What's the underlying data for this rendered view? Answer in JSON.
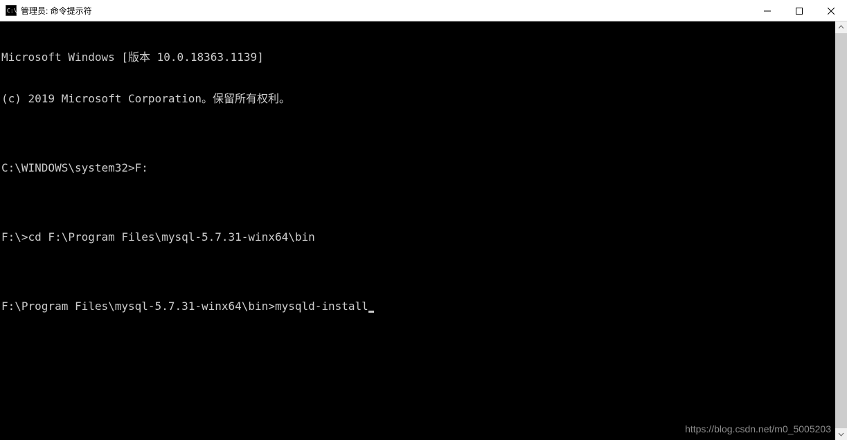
{
  "window": {
    "title": "管理员: 命令提示符"
  },
  "terminal": {
    "line1": "Microsoft Windows [版本 10.0.18363.1139]",
    "line2": "(c) 2019 Microsoft Corporation。保留所有权利。",
    "blank1": "",
    "prompt1": "C:\\WINDOWS\\system32>F:",
    "blank2": "",
    "prompt2": "F:\\>cd F:\\Program Files\\mysql-5.7.31-winx64\\bin",
    "blank3": "",
    "prompt3_prefix": "F:\\Program Files\\mysql-5.7.31-winx64\\bin>mysqld-install"
  },
  "watermark": "https://blog.csdn.net/m0_5005203"
}
